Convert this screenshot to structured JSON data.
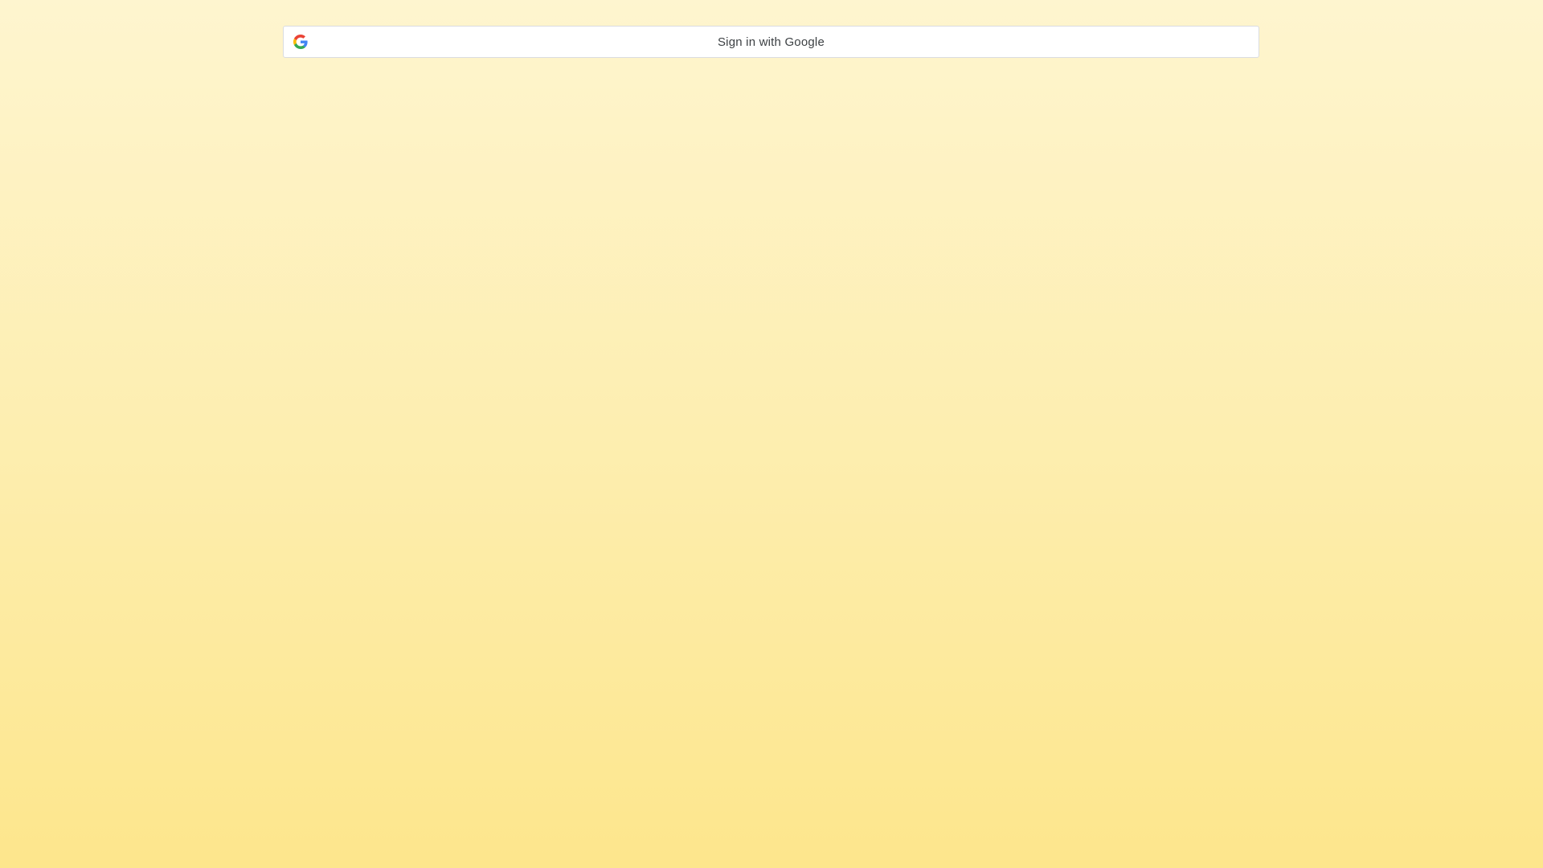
{
  "signin": {
    "label": "Sign in with Google",
    "icon": "google-g-icon"
  },
  "colors": {
    "background_top": "#fef5cf",
    "background_bottom": "#fde68c",
    "button_background": "#ffffff",
    "button_border": "#dadce0",
    "button_text": "#3c4043",
    "google_blue": "#4285F4",
    "google_red": "#EA4335",
    "google_yellow": "#FBBC05",
    "google_green": "#34A853"
  }
}
